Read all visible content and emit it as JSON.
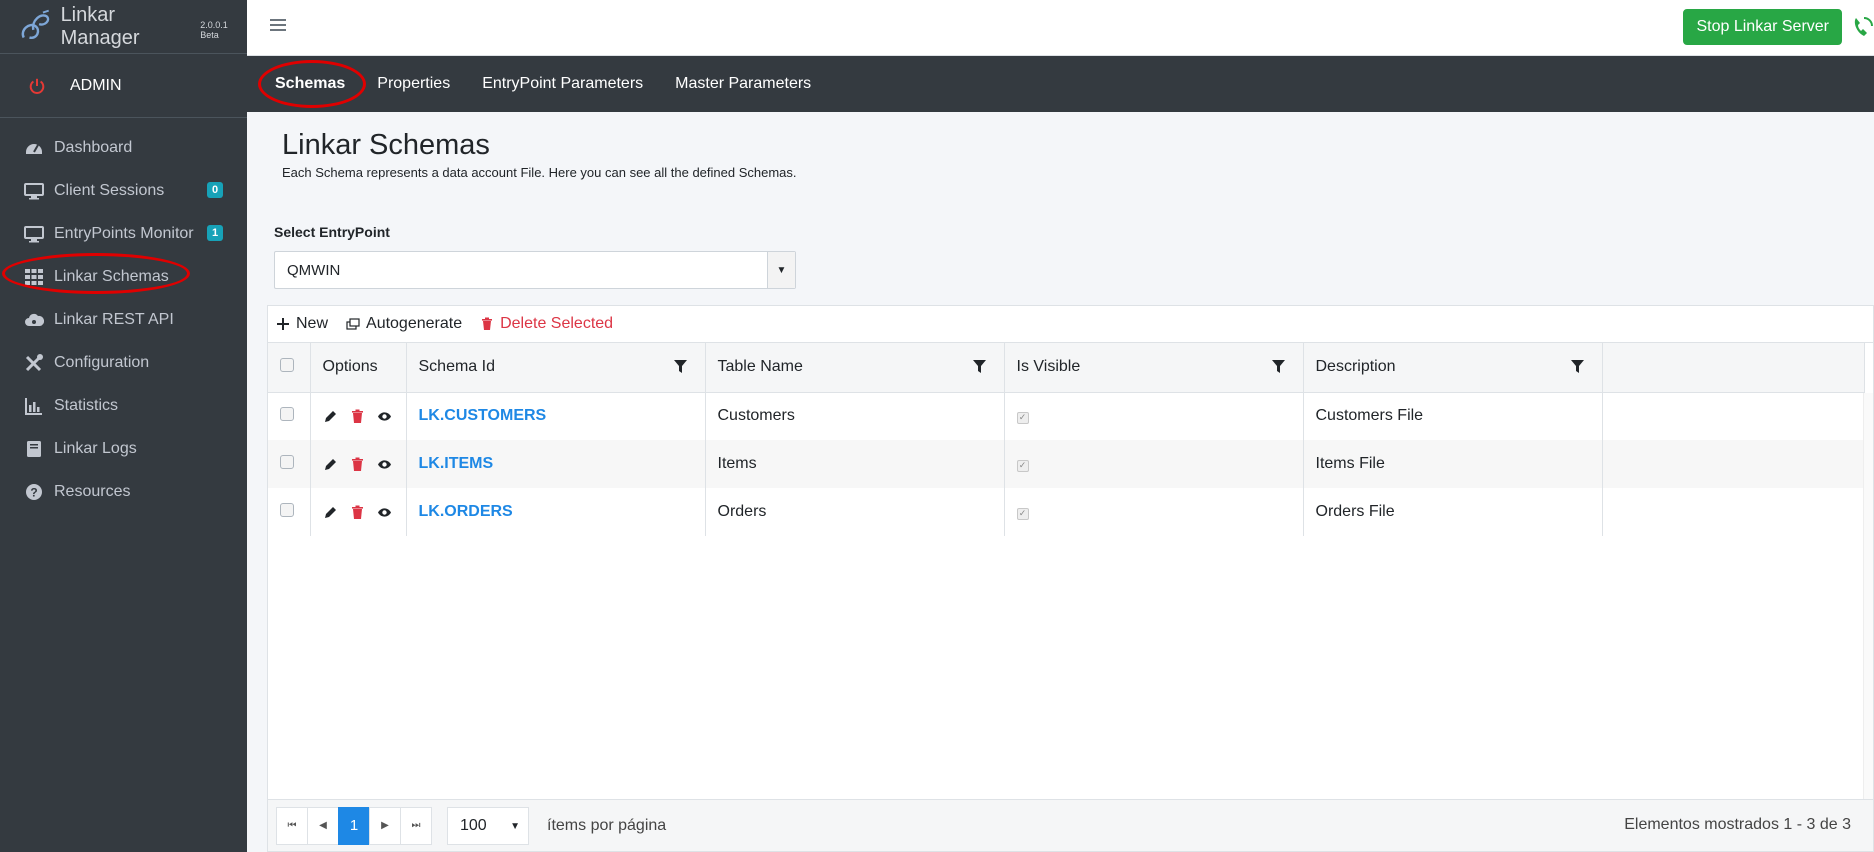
{
  "brand": {
    "name": "Linkar Manager",
    "version": "2.0.0.1 Beta"
  },
  "user": {
    "name": "ADMIN"
  },
  "sidebar": {
    "items": [
      {
        "label": "Dashboard",
        "icon": "dashboard-icon"
      },
      {
        "label": "Client Sessions",
        "icon": "monitor-icon",
        "badge": "0"
      },
      {
        "label": "EntryPoints Monitor",
        "icon": "monitor-icon",
        "badge": "1"
      },
      {
        "label": "Linkar Schemas",
        "icon": "grid-icon"
      },
      {
        "label": "Linkar REST API",
        "icon": "cloud-icon"
      },
      {
        "label": "Configuration",
        "icon": "tools-icon"
      },
      {
        "label": "Statistics",
        "icon": "chart-icon"
      },
      {
        "label": "Linkar Logs",
        "icon": "book-icon"
      },
      {
        "label": "Resources",
        "icon": "question-icon"
      }
    ]
  },
  "header": {
    "stop_label": "Stop Linkar Server"
  },
  "tabs": [
    {
      "label": "Schemas"
    },
    {
      "label": "Properties"
    },
    {
      "label": "EntryPoint Parameters"
    },
    {
      "label": "Master Parameters"
    }
  ],
  "page": {
    "title": "Linkar Schemas",
    "subtitle": "Each Schema represents a data account File. Here you can see all the defined Schemas."
  },
  "entrypoint": {
    "label": "Select EntryPoint",
    "value": "QMWIN"
  },
  "toolbar": {
    "new_label": "New",
    "autogen_label": "Autogenerate",
    "delete_label": "Delete Selected"
  },
  "table": {
    "columns": [
      "Options",
      "Schema Id",
      "Table Name",
      "Is Visible",
      "Description"
    ],
    "rows": [
      {
        "schema_id": "LK.CUSTOMERS",
        "table_name": "Customers",
        "is_visible": true,
        "description": "Customers File"
      },
      {
        "schema_id": "LK.ITEMS",
        "table_name": "Items",
        "is_visible": true,
        "description": "Items File"
      },
      {
        "schema_id": "LK.ORDERS",
        "table_name": "Orders",
        "is_visible": true,
        "description": "Orders File"
      }
    ]
  },
  "pager": {
    "current_page": "1",
    "page_size": "100",
    "page_size_label": "ítems por página",
    "info": "Elementos mostrados 1 - 3 de 3"
  },
  "colors": {
    "sidebar_bg": "#343a40",
    "accent": "#1e88e5",
    "success": "#28a745",
    "danger": "#dc3545",
    "annotation": "#e00000"
  }
}
